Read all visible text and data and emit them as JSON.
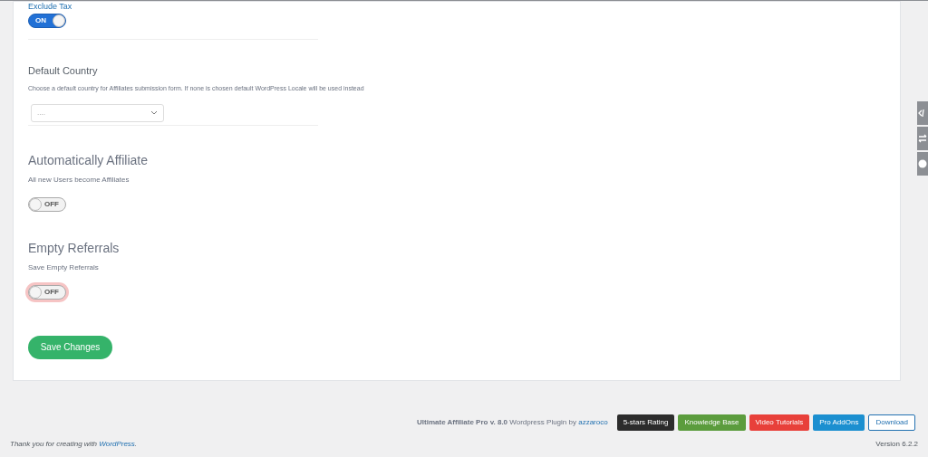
{
  "settings": [
    {
      "kind": "toggle_compact",
      "title": "Exclude Tax",
      "toggle": {
        "on": true,
        "label": "ON",
        "highlighted": false
      }
    },
    {
      "kind": "select",
      "title": "Default Country",
      "description": "Choose a default country for Affiliates submission form. If none is chosen default WordPress Locale will be used instead",
      "select": {
        "value": "...."
      }
    },
    {
      "kind": "toggle",
      "title": "Automatically Affiliate",
      "description": "All new Users become Affiliates",
      "toggle": {
        "on": false,
        "label": "OFF",
        "highlighted": false
      }
    },
    {
      "kind": "toggle",
      "title": "Empty Referrals",
      "description": "Save Empty Referrals",
      "toggle": {
        "on": false,
        "label": "OFF",
        "highlighted": true
      }
    }
  ],
  "save_button": "Save Changes",
  "plugin_credit": {
    "text": "**Ultimate Affiliate Pro v. 8.0** Wordpress Plugin by",
    "link": "azzaroco"
  },
  "footer_buttons": [
    {
      "label": "5-stars Rating",
      "color": "#2c2c2c"
    },
    {
      "label": "Knowledge Base",
      "color": "#5b9c3d"
    },
    {
      "label": "Video Tutorials",
      "color": "#e8403a"
    },
    {
      "label": "Pro AddOns",
      "color": "#1b8fd0"
    },
    {
      "label": "Download",
      "color": "#ffffff"
    }
  ],
  "thank_you": {
    "text": "Thank you for creating with",
    "link": "WordPress",
    "suffix": "."
  },
  "version": "Version 6.2.2"
}
